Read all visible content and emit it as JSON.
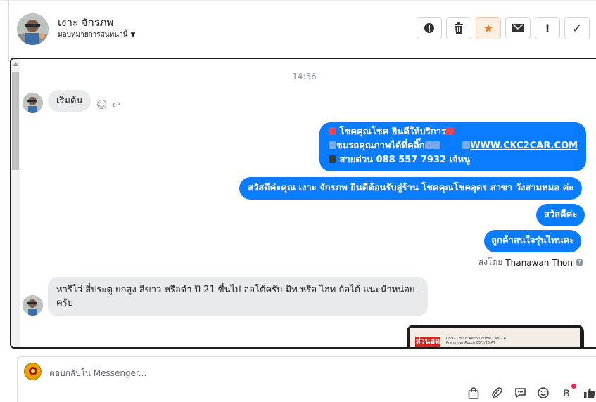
{
  "contact": {
    "name": "เงาะ จักรภพ",
    "assign_label": "มอบหมายการสนทนานี้"
  },
  "actions": [
    {
      "name": "spam-button",
      "icon": "alert-circle-icon",
      "glyph": "⓿"
    },
    {
      "name": "delete-button",
      "icon": "trash-icon",
      "glyph": "🗑"
    },
    {
      "name": "star-button",
      "icon": "star-icon",
      "glyph": "★"
    },
    {
      "name": "mark-unread-button",
      "icon": "envelope-icon",
      "glyph": "✉"
    },
    {
      "name": "follow-up-button",
      "icon": "exclamation-icon",
      "glyph": "!"
    },
    {
      "name": "mark-done-button",
      "icon": "check-icon",
      "glyph": "✓"
    }
  ],
  "conversation": {
    "timestamp": "14:56",
    "first_incoming": "เริ่มต้น",
    "outgoing": {
      "welcome": {
        "line1": "โชคคุณโชค ยินดีให้บริการ",
        "line2_text": "ชมรถคุณภาพได้ที่คลิ๊ก",
        "line2_link": "WWW.CKC2CAR.COM",
        "line3": "สายด่วน 088 557 7932 เจ้หนู"
      },
      "greeting": "สวัสดีค่ะคุณ เงาะ จักรภพ ยินดีต้อนรับสู่ร้าน โชคคุณโชคอุดร สาขา วังสามหมอ ค่ะ",
      "hello": "สวัสดีค่ะ",
      "question": "ลูกค้าสนใจรุ่นไหนคะ"
    },
    "sent_by_prefix": "ส่งโดย",
    "sent_by_name": "Thanawan Thon",
    "incoming_reply": "หารีโว่ สี่ประตู ยกสูง  สีขาว หรือดำ ปี 21 ขึ้นไป  ออโต้ครับ มิท  หรือ  ไฮท ก้อได้ แนะนำหน่อยครับ",
    "image_promo": "ส่วนลด",
    "image_caption_1": "U592 - Hilux Revo Double Cab 2.4",
    "image_caption_2": "Prerunner Rocco 05/1/20 AT"
  },
  "composer": {
    "placeholder": "ตอบกลับใน Messenger..."
  },
  "colors": {
    "outgoing_bubble": "#0a7cff",
    "incoming_bubble": "#e9eaee",
    "star_accent": "#f07c1b"
  }
}
